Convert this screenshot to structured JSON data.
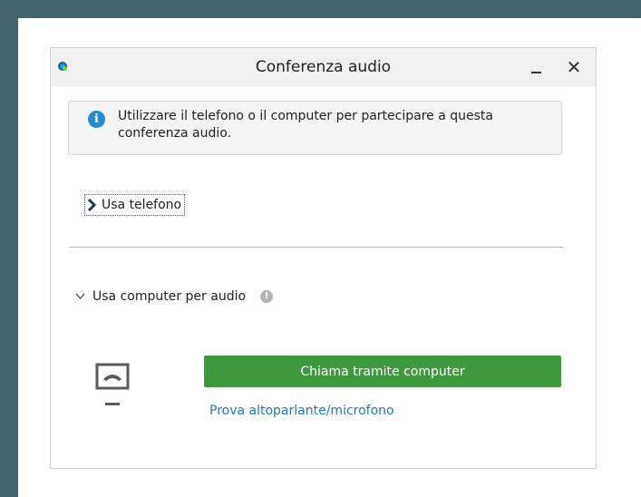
{
  "window": {
    "title": "Conferenza audio",
    "close_symbol": "✕"
  },
  "info": {
    "icon": "i",
    "text": "Utilizzare il telefono o il computer per partecipare a questa conferenza audio."
  },
  "phone_section": {
    "label": "Usa telefono",
    "expanded": false
  },
  "computer_section": {
    "label": "Usa computer per audio",
    "help_icon": "!",
    "expanded": true,
    "call_button_label": "Chiama tramite computer",
    "test_link_label": "Prova altoparlante/microfono"
  },
  "colors": {
    "background": "#436570",
    "accent_green": "#3f9a3e",
    "link_blue": "#1f7ab8",
    "info_blue": "#1e8fd6"
  },
  "icons": [
    "app-logo-icon",
    "minimize-icon",
    "close-icon",
    "info-icon",
    "chevron-right-icon",
    "chevron-down-icon",
    "help-icon",
    "computer-audio-icon"
  ]
}
